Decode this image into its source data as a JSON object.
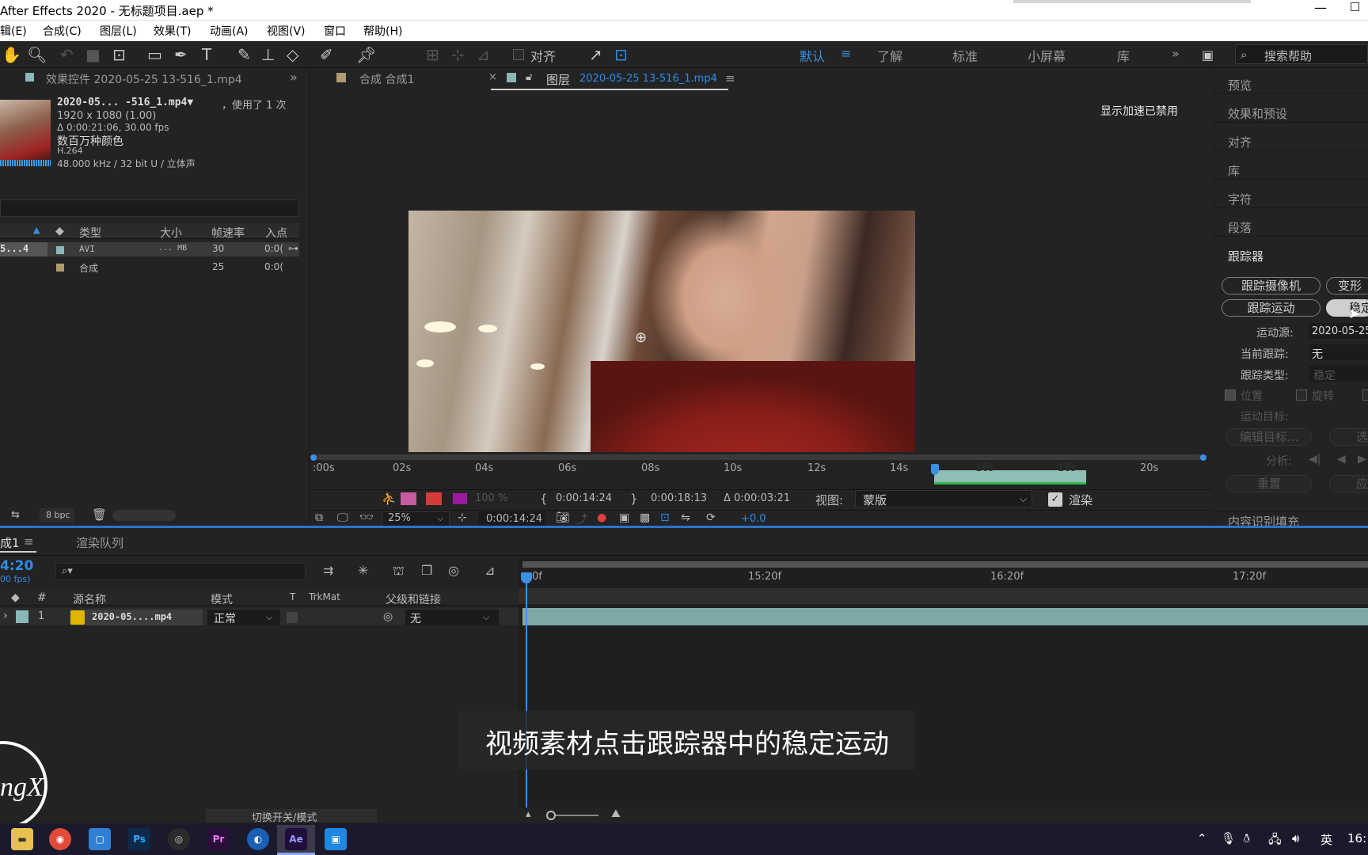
{
  "window": {
    "title": "After Effects 2020 - 无标题项目.aep *",
    "minimize": "—",
    "maximize": "□"
  },
  "menu": [
    "辑(E)",
    "合成(C)",
    "图层(L)",
    "效果(T)",
    "动画(A)",
    "视图(V)",
    "窗口",
    "帮助(H)"
  ],
  "toolbar": {
    "align_label": "对齐",
    "workspaces": [
      "默认",
      "了解",
      "标准",
      "小屏幕",
      "库"
    ],
    "more": "»",
    "search_placeholder": "搜索帮助"
  },
  "left_panel": {
    "tab_title": "效果控件 2020-05-25 13-516_1.mp4",
    "more": "»",
    "footage_name": "2020-05... -516_1.mp4▼",
    "used": "，使用了 1 次",
    "dimensions": "1920 x 1080 (1.00)",
    "duration": "Δ 0:00:21:06, 30.00 fps",
    "colors": "数百万种颜色",
    "codec": "H.264",
    "audio": "48.000 kHz / 32 bit U / 立体声",
    "columns": [
      "类型",
      "大小",
      "帧速率",
      "入点"
    ],
    "rows": [
      {
        "name": "5...4",
        "type": "AVI",
        "size": "... MB",
        "fps": "30",
        "in": "0:0("
      },
      {
        "name": "",
        "type": "合成",
        "size": "",
        "fps": "25",
        "in": "0:0("
      }
    ],
    "bpc": "8 bpc"
  },
  "viewer": {
    "tab_comp": "合成 合成1",
    "tab_layer_prefix": "图层",
    "tab_layer_name": "2020-05-25 13-516_1.mp4",
    "accel_notice": "显示加速已禁用",
    "ruler_ticks": [
      ":00s",
      "02s",
      "04s",
      "06s",
      "08s",
      "10s",
      "12s",
      "14s",
      "16s",
      "18s",
      "20s"
    ],
    "opacity": "100 %",
    "in_time": "0:00:14:24",
    "out_time": "0:00:18:13",
    "duration": "Δ 0:00:03:21",
    "view_label": "视图:",
    "view_value": "蒙版",
    "render_label": "渲染",
    "zoom": "25%",
    "current_time": "0:00:14:24",
    "exposure": "+0.0"
  },
  "right_panel": {
    "items": [
      "预览",
      "效果和预设",
      "对齐",
      "库",
      "字符",
      "段落"
    ],
    "tracker_title": "跟踪器",
    "btn_track_camera": "跟踪摄像机",
    "btn_warp": "变形",
    "btn_track_motion": "跟踪运动",
    "btn_stabilize": "稳定",
    "motion_source_label": "运动源:",
    "motion_source_value": "2020-05-25",
    "current_track_label": "当前跟踪:",
    "current_track_value": "无",
    "track_type_label": "跟踪类型:",
    "track_type_value": "稳定",
    "position": "位置",
    "rotation": "旋转",
    "motion_target": "运动目标:",
    "edit_target": "编辑目标...",
    "options": "选",
    "analyze": "分析:",
    "reset": "重置",
    "apply": "应",
    "content_fill": "内容识别填充"
  },
  "timeline": {
    "tab_label": "成1",
    "render_queue": "渲染队列",
    "timecode": "4:20",
    "fps_note": "00 fps)",
    "columns": [
      "#",
      "源名称",
      "模式",
      "T",
      "TrkMat",
      "父级和链接"
    ],
    "layer": {
      "num": "1",
      "name": "2020-05....mp4",
      "mode": "正常",
      "parent": "无"
    },
    "ruler": [
      "0f",
      "15:20f",
      "16:20f",
      "17:20f"
    ],
    "toggle_modes": "切换开关/模式"
  },
  "subtitle": "视频素材点击跟踪器中的稳定运动",
  "watermark": "ngX",
  "taskbar": {
    "apps": [
      "Ps",
      "Pr",
      "Ae"
    ],
    "ime": "英",
    "clock": "16:"
  },
  "colors": {
    "accent": "#2d8ceb",
    "panel": "#232323",
    "stabilize_bg": "#cfcfcf",
    "timeline_bar": "#7fa9a9"
  }
}
